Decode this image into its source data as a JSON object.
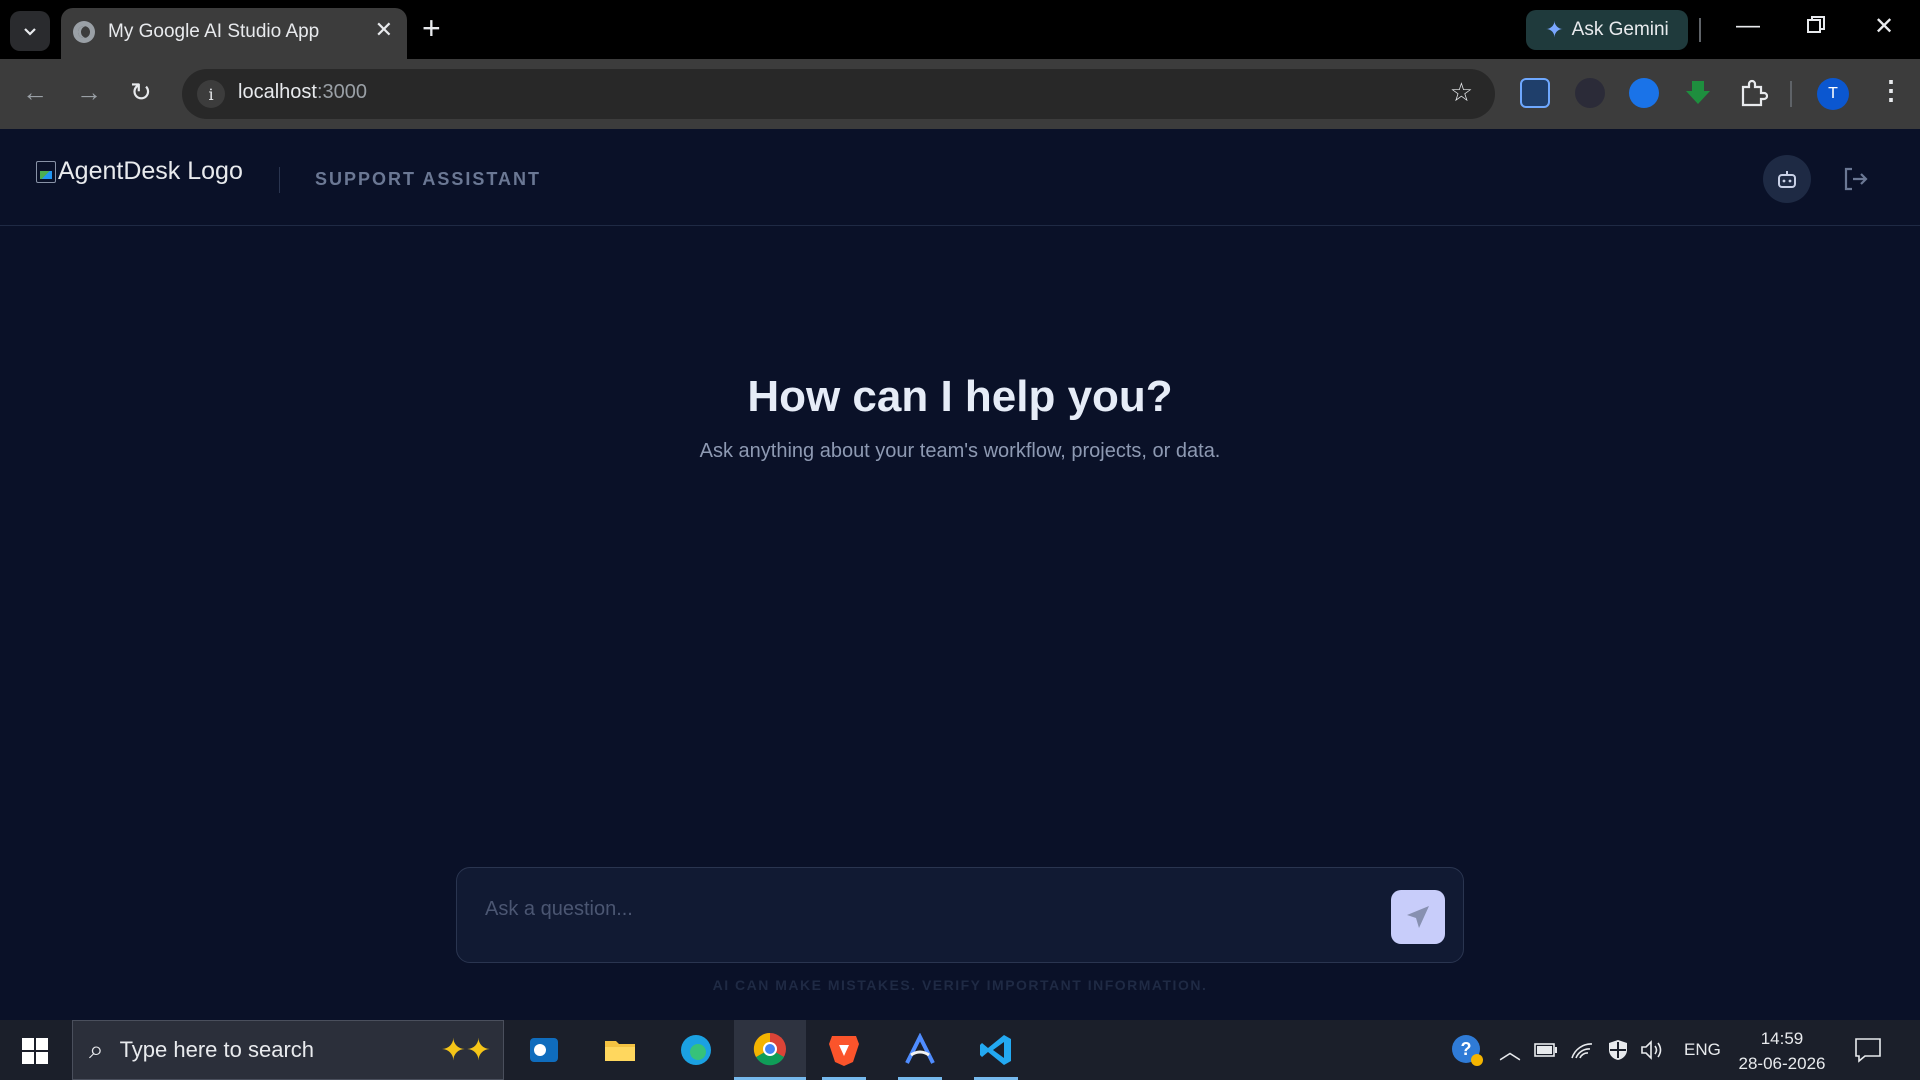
{
  "browser": {
    "tab_title": "My Google AI Studio App",
    "url_host": "localhost",
    "url_port": ":3000",
    "ask_gemini_label": "Ask Gemini",
    "profile_initial": "T"
  },
  "app": {
    "logo_alt": "AgentDesk Logo",
    "subtitle": "SUPPORT ASSISTANT",
    "hero_title": "How can I help you?",
    "hero_subtitle": "Ask anything about your team's workflow, projects, or data.",
    "composer_placeholder": "Ask a question...",
    "disclaimer": "AI CAN MAKE MISTAKES. VERIFY IMPORTANT INFORMATION.",
    "colors": {
      "background": "#0a1128",
      "accent": "#c8cdfa",
      "header_border": "#1f2a44"
    }
  },
  "taskbar": {
    "search_placeholder": "Type here to search",
    "language": "ENG",
    "time": "14:59",
    "date": "28-06-2026",
    "apps": [
      "outlook-icon",
      "file-explorer-icon",
      "edge-icon",
      "chrome-icon",
      "brave-icon",
      "arc-icon",
      "vscode-icon"
    ]
  }
}
